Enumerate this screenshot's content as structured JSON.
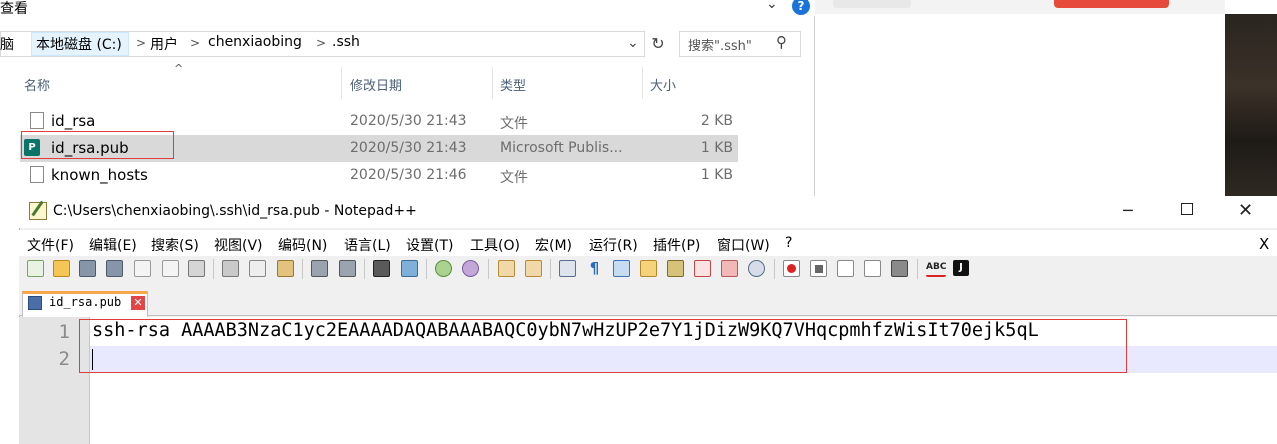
{
  "explorer": {
    "ribbon_label": "查看",
    "help_glyph": "?",
    "address": {
      "segments": [
        "脑",
        "本地磁盘 (C:)",
        "用户",
        "chenxiaobing",
        ".ssh"
      ],
      "separator": ">"
    },
    "search_placeholder": "搜索\".ssh\"",
    "columns": [
      "名称",
      "修改日期",
      "类型",
      "大小"
    ],
    "files": [
      {
        "name": "id_rsa",
        "modified": "2020/5/30 21:43",
        "type": "文件",
        "size": "2 KB",
        "icon": "file-icon",
        "selected": false
      },
      {
        "name": "id_rsa.pub",
        "modified": "2020/5/30 21:43",
        "type": "Microsoft Publis...",
        "size": "1 KB",
        "icon": "publisher-icon",
        "selected": true
      },
      {
        "name": "known_hosts",
        "modified": "2020/5/30 21:46",
        "type": "文件",
        "size": "1 KB",
        "icon": "file-icon",
        "selected": false
      }
    ]
  },
  "notepad": {
    "title": "C:\\Users\\chenxiaobing\\.ssh\\id_rsa.pub - Notepad++",
    "menu": [
      "文件(F)",
      "编辑(E)",
      "搜索(S)",
      "视图(V)",
      "编码(N)",
      "语言(L)",
      "设置(T)",
      "工具(O)",
      "宏(M)",
      "运行(R)",
      "插件(P)",
      "窗口(W)",
      "?"
    ],
    "menu_close": "X",
    "tab": {
      "label": "id_rsa.pub",
      "close_glyph": "✕"
    },
    "line_numbers": [
      "1",
      "2"
    ],
    "lines": [
      "ssh-rsa AAAAB3NzaC1yc2EAAAADAQABAAABAQC0ybN7wHzUP2e7Y1jDizW9KQ7VHqcpmhfzWisIt70ejk5qL",
      ""
    ],
    "window_buttons": {
      "minimize": "─",
      "close": "✕"
    }
  },
  "colors": {
    "highlight_box": "#e03c3c",
    "selected_row": "#d9d9d9",
    "line_highlight": "#e8e8ff",
    "tab_accent": "#f7a64a"
  }
}
